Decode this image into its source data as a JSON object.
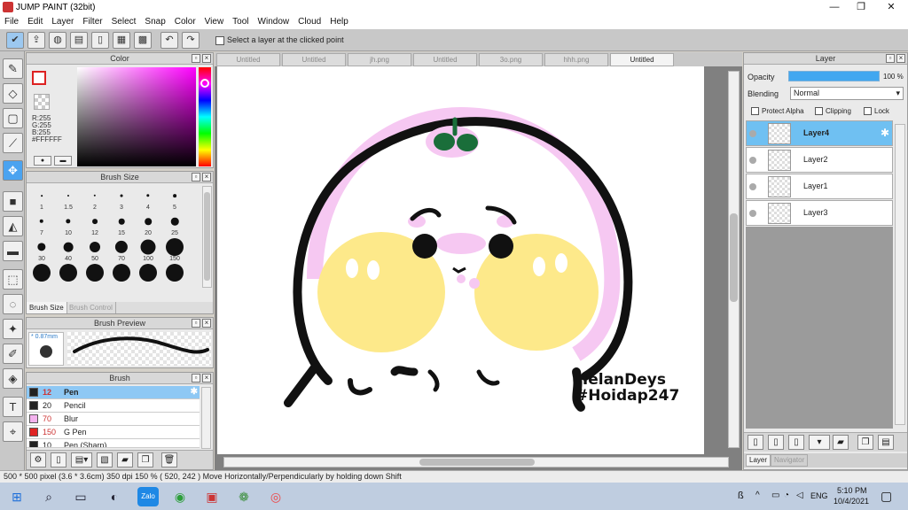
{
  "window": {
    "title": "JUMP PAINT (32bit)",
    "minimize": "—",
    "maximize": "❐",
    "close": "✕"
  },
  "menu": [
    "File",
    "Edit",
    "Layer",
    "Filter",
    "Select",
    "Snap",
    "Color",
    "View",
    "Tool",
    "Window",
    "Cloud",
    "Help"
  ],
  "toolbar": {
    "select_layer_label": "Select a layer at the clicked point",
    "select_layer_checked": false
  },
  "color_panel": {
    "title": "Color",
    "r": "R:255",
    "g": "G:255",
    "b": "B:255",
    "hex": "#FFFFFF",
    "fg_border_color": "#dd2222"
  },
  "brush_size_panel": {
    "title": "Brush Size",
    "sizes": [
      "1",
      "1.5",
      "2",
      "3",
      "4",
      "5",
      "7",
      "10",
      "12",
      "15",
      "20",
      "25",
      "30",
      "40",
      "50",
      "70",
      "100",
      "150",
      "",
      "",
      "",
      "",
      "",
      ""
    ],
    "tab_active": "Brush Size",
    "tab_inactive": "Brush Control"
  },
  "brush_preview": {
    "title": "Brush Preview",
    "size_label": "* 0.87mm"
  },
  "brush_panel": {
    "title": "Brush",
    "brushes": [
      {
        "size": "12",
        "name": "Pen",
        "color": "#222222",
        "selected": true
      },
      {
        "size": "20",
        "name": "Pencil",
        "color": "#222222",
        "selected": false
      },
      {
        "size": "70",
        "name": "Blur",
        "color": "#f4b2ee",
        "selected": false
      },
      {
        "size": "150",
        "name": "G Pen",
        "color": "#e02424",
        "selected": false
      },
      {
        "size": "10",
        "name": "Pen (Sharp)",
        "color": "#222222",
        "selected": false
      }
    ]
  },
  "canvas_tabs": [
    "Untitled",
    "Untitled",
    "jh.png",
    "Untitled",
    "3o.png",
    "hhh.png",
    "Untitled"
  ],
  "canvas_tabs_active_index": 6,
  "artwork": {
    "signature_line1": "HelanDeys",
    "signature_line2": "#Hoidap247"
  },
  "layer_panel": {
    "title": "Layer",
    "opacity_label": "Opacity",
    "opacity_value": "100 %",
    "blending_label": "Blending",
    "blending_value": "Normal",
    "protect_alpha": "Protect Alpha",
    "clipping": "Clipping",
    "lock": "Lock",
    "layers": [
      {
        "name": "Layer4",
        "selected": true
      },
      {
        "name": "Layer2",
        "selected": false
      },
      {
        "name": "Layer1",
        "selected": false
      },
      {
        "name": "Layer3",
        "selected": false
      }
    ],
    "tab_layer": "Layer",
    "tab_navigator": "Navigator"
  },
  "status_bar": {
    "text": "500 * 500 pixel   (3.6 * 3.6cm)   350 dpi   150 %   ( 520, 242 )   Move Horizontally/Perpendicularly by holding down Shift"
  },
  "taskbar": {
    "lang": "ENG",
    "time": "5:10 PM",
    "date": "10/4/2021",
    "zalo_label": "Zalo",
    "ime": "ß"
  }
}
